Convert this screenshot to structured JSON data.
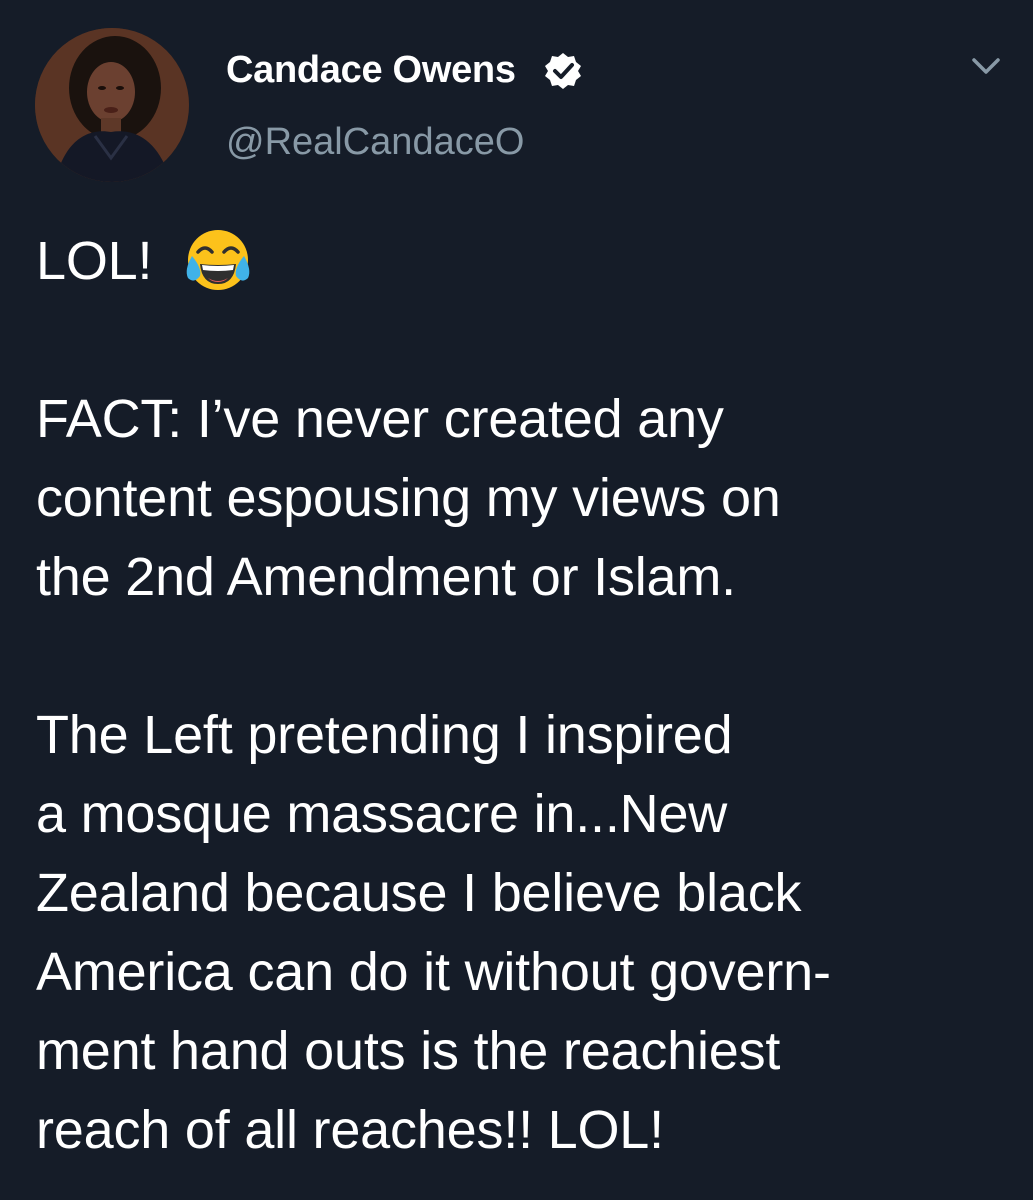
{
  "tweet": {
    "display_name": "Candace Owens",
    "handle": "@RealCandaceO",
    "verified_icon": "verified-badge-icon",
    "menu_icon": "chevron-down-icon",
    "emoji": "face-with-tears-of-joy",
    "lines": {
      "l1": "LOL!",
      "l2": "FACT: I’ve never created any",
      "l3": "content espousing my views on",
      "l4": "the 2nd Amendment or Islam.",
      "l5": "The Left pretending I inspired",
      "l6": "a mosque massacre in...New",
      "l7": "Zealand because I believe black",
      "l8": "America can do it without govern-",
      "l9": "ment hand outs is the reachiest",
      "l10": "reach of all reaches!! LOL!"
    }
  },
  "colors": {
    "background": "#151c28",
    "text": "#ffffff",
    "secondary_text": "#8899a6"
  }
}
